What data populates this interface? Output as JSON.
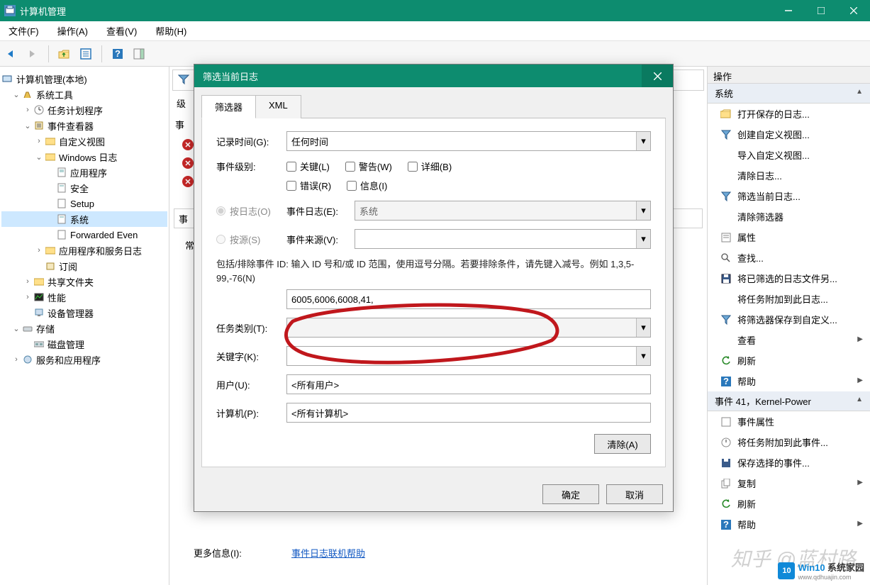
{
  "window": {
    "title": "计算机管理",
    "minimize": "–",
    "maximize": "❐",
    "close": "✕"
  },
  "menu": {
    "file": "文件(F)",
    "action": "操作(A)",
    "view": "查看(V)",
    "help": "帮助(H)"
  },
  "tree": {
    "root": "计算机管理(本地)",
    "systools": "系统工具",
    "tasksched": "任务计划程序",
    "evtviewer": "事件查看器",
    "customview": "自定义视图",
    "winlogs": "Windows 日志",
    "application": "应用程序",
    "security": "安全",
    "setup": "Setup",
    "system": "系统",
    "forwarded": "Forwarded Even",
    "appsvclogs": "应用程序和服务日志",
    "subscription": "订阅",
    "sharedfold": "共享文件夹",
    "perf": "性能",
    "devmgr": "设备管理器",
    "storage": "存储",
    "diskmgmt": "磁盘管理",
    "svcapp": "服务和应用程序"
  },
  "center": {
    "filter_icon_left": "筛",
    "level_col": "级",
    "event_label": "事",
    "general_tab_abbrev": "常",
    "moreinfo": "更多信息(I):",
    "link": "事件日志联机帮助"
  },
  "dialog": {
    "title": "筛选当前日志",
    "close": "✕",
    "tab_filter": "筛选器",
    "tab_xml": "XML",
    "recordtime_lbl": "记录时间(G):",
    "recordtime_val": "任何时间",
    "level_lbl": "事件级别:",
    "chk_critical": "关键(L)",
    "chk_warning": "警告(W)",
    "chk_verbose": "详细(B)",
    "chk_error": "错误(R)",
    "chk_info": "信息(I)",
    "radio_bylog": "按日志(O)",
    "radio_bysource": "按源(S)",
    "eventlog_lbl": "事件日志(E):",
    "eventlog_val": "系统",
    "eventsrc_lbl": "事件来源(V):",
    "eventsrc_val": "",
    "ids_help": "包括/排除事件 ID: 输入 ID 号和/或 ID 范围，使用逗号分隔。若要排除条件，请先键入减号。例如 1,3,5-99,-76(N)",
    "ids_val": "6005,6006,6008,41,",
    "taskcat_lbl": "任务类别(T):",
    "taskcat_val": "",
    "keyword_lbl": "关键字(K):",
    "keyword_val": "",
    "user_lbl": "用户(U):",
    "user_val": "<所有用户>",
    "computer_lbl": "计算机(P):",
    "computer_val": "<所有计算机>",
    "clear_btn": "清除(A)",
    "ok_btn": "确定",
    "cancel_btn": "取消"
  },
  "actions": {
    "header": "操作",
    "sub_system": "系统",
    "open_saved": "打开保存的日志...",
    "create_custom": "创建自定义视图...",
    "import_custom": "导入自定义视图...",
    "clear_log": "清除日志...",
    "filter_current": "筛选当前日志...",
    "clear_filter": "清除筛选器",
    "properties": "属性",
    "find": "查找...",
    "save_filtered": "将已筛选的日志文件另...",
    "attach_task_log": "将任务附加到此日志...",
    "save_filter_custom": "将筛选器保存到自定义...",
    "view": "查看",
    "refresh": "刷新",
    "help": "帮助",
    "sub_event": "事件 41，Kernel-Power",
    "event_props": "事件属性",
    "attach_task_evt": "将任务附加到此事件...",
    "save_selected": "保存选择的事件...",
    "copy": "复制",
    "refresh2": "刷新",
    "help2": "帮助"
  },
  "watermark": "知乎  @蓝村路",
  "logo": {
    "brand": "Win10",
    "sub": "系统家园",
    "url": "www.qdhuajin.com"
  }
}
